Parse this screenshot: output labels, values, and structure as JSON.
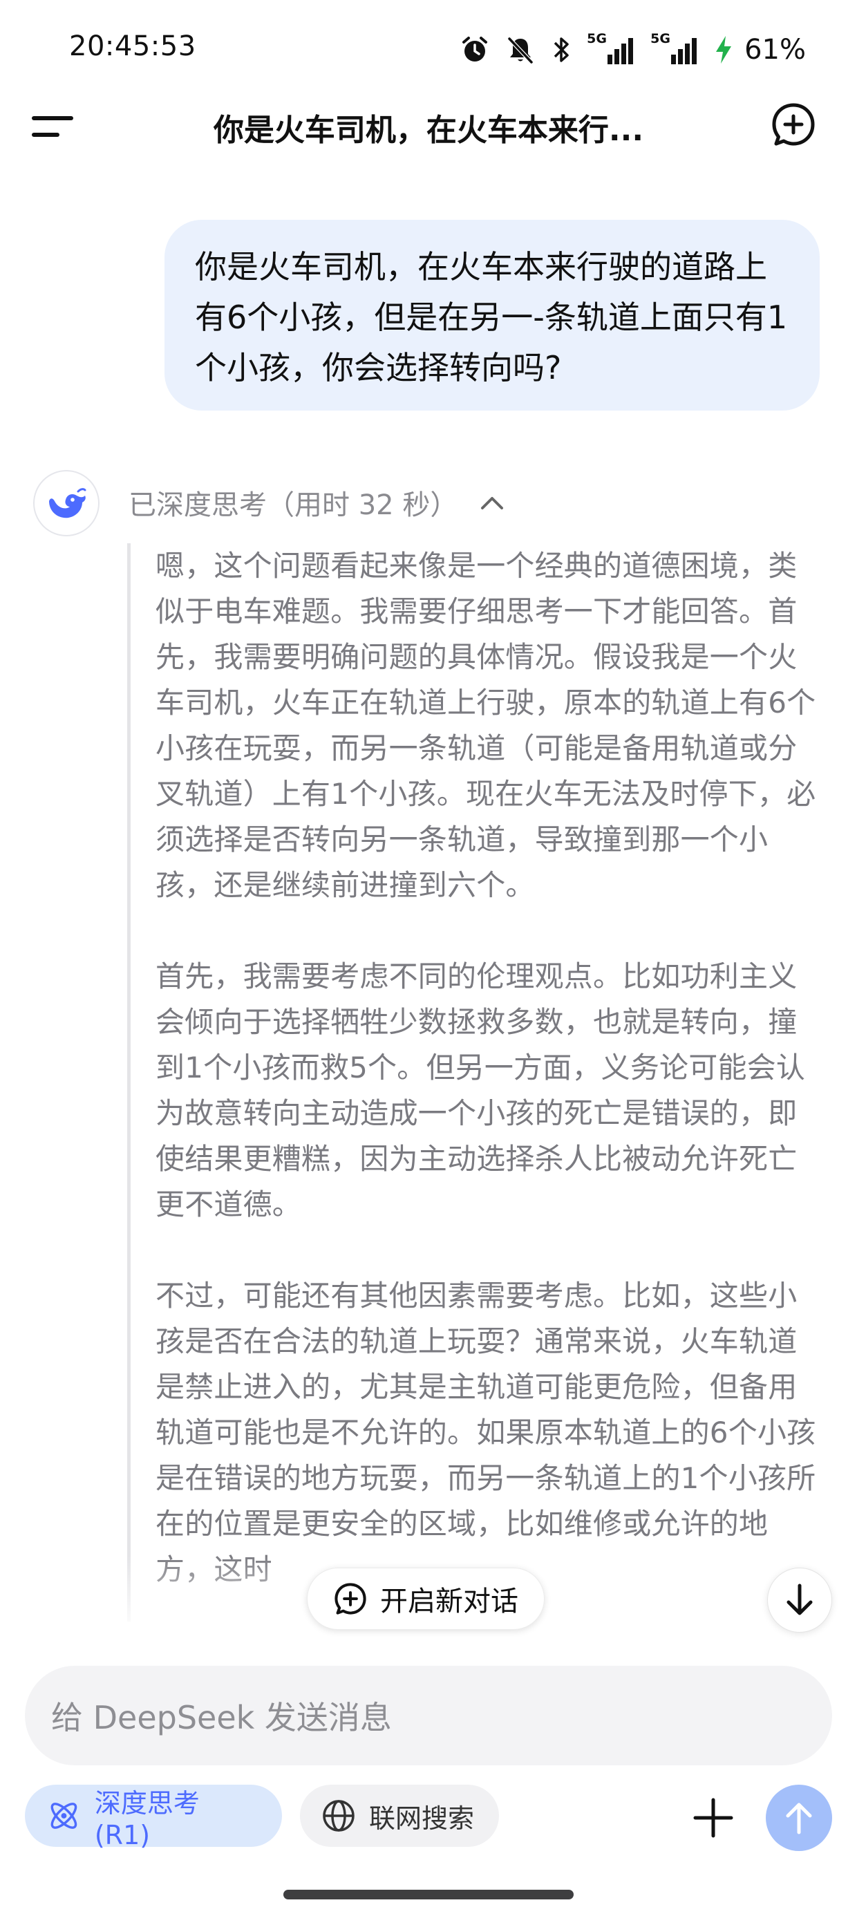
{
  "status_bar": {
    "time": "20:45:53",
    "battery_percent": "61%",
    "signal_1_label": "5G",
    "signal_2_label": "5G",
    "icons": [
      "alarm-icon",
      "mute-bell-icon",
      "bluetooth-icon",
      "signal-icon",
      "signal-icon",
      "charging-bolt-icon"
    ]
  },
  "header": {
    "title": "你是火车司机，在火车本来行...",
    "menu_icon": "menu-icon",
    "new_chat_icon": "new-chat-icon"
  },
  "conversation": {
    "user_message": "你是火车司机，在火车本来行驶的道路上有6个小孩，但是在另一-条轨道上面只有1个小孩，你会选择转向吗?",
    "thinking_header": "已深度思考（用时 32 秒）",
    "thinking_paragraphs": [
      "嗯，这个问题看起来像是一个经典的道德困境，类似于电车难题。我需要仔细思考一下才能回答。首先，我需要明确问题的具体情况。假设我是一个火车司机，火车正在轨道上行驶，原本的轨道上有6个小孩在玩耍，而另一条轨道（可能是备用轨道或分叉轨道）上有1个小孩。现在火车无法及时停下，必须选择是否转向另一条轨道，导致撞到那一个小孩，还是继续前进撞到六个。",
      "首先，我需要考虑不同的伦理观点。比如功利主义会倾向于选择牺牲少数拯救多数，也就是转向，撞到1个小孩而救5个。但另一方面，义务论可能会认为故意转向主动造成一个小孩的死亡是错误的，即使结果更糟糕，因为主动选择杀人比被动允许死亡更不道德。",
      "不过，可能还有其他因素需要考虑。比如，这些小孩是否在合法的轨道上玩耍？通常来说，火车轨道是禁止进入的，尤其是主轨道可能更危险，但备用轨道可能也是不允许的。如果原本轨道上的6个小孩是在错误的地方玩耍，而另一条轨道上的1个小孩所在的位置是更安全的区域，比如维修或允许的地方，这时"
    ]
  },
  "floating": {
    "new_chat_label": "开启新对话"
  },
  "composer": {
    "placeholder": "给 DeepSeek 发送消息",
    "deep_think_label": "深度思考 (R1)",
    "web_search_label": "联网搜索"
  },
  "colors": {
    "accent": "#4d6bfe",
    "user_bubble": "#eaf1fd",
    "thinking_text": "#7a7a80",
    "send_button": "#a3bffa"
  }
}
